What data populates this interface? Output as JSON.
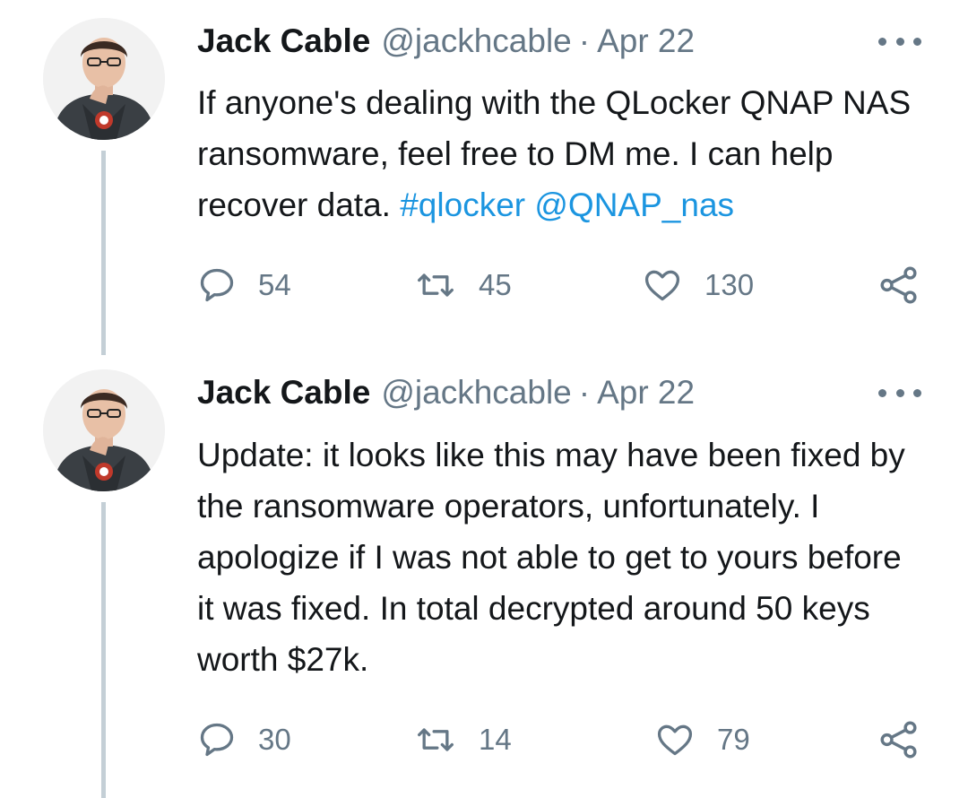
{
  "tweets": [
    {
      "author_name": "Jack Cable",
      "handle": "@jackhcable",
      "separator": "·",
      "date": "Apr 22",
      "text_parts": {
        "plain": "If anyone's dealing with the QLocker QNAP NAS ransomware, feel free to DM me. I can help recover data. ",
        "hashtag": "#qlocker",
        "space": " ",
        "mention": "@QNAP_nas"
      },
      "replies": "54",
      "retweets": "45",
      "likes": "130"
    },
    {
      "author_name": "Jack Cable",
      "handle": "@jackhcable",
      "separator": "·",
      "date": "Apr 22",
      "text": "Update: it looks like this may have been fixed by the ransomware operators, unfortunately. I apologize if I was not able to get to yours before it was fixed. In total decrypted around 50 keys worth $27k.",
      "replies": "30",
      "retweets": "14",
      "likes": "79"
    }
  ],
  "colors": {
    "text": "#14171a",
    "secondary": "#657786",
    "link": "#1b95e0",
    "thread_line": "#c4cfd6"
  },
  "icons": [
    "reply-icon",
    "retweet-icon",
    "like-icon",
    "share-icon",
    "more-icon"
  ]
}
